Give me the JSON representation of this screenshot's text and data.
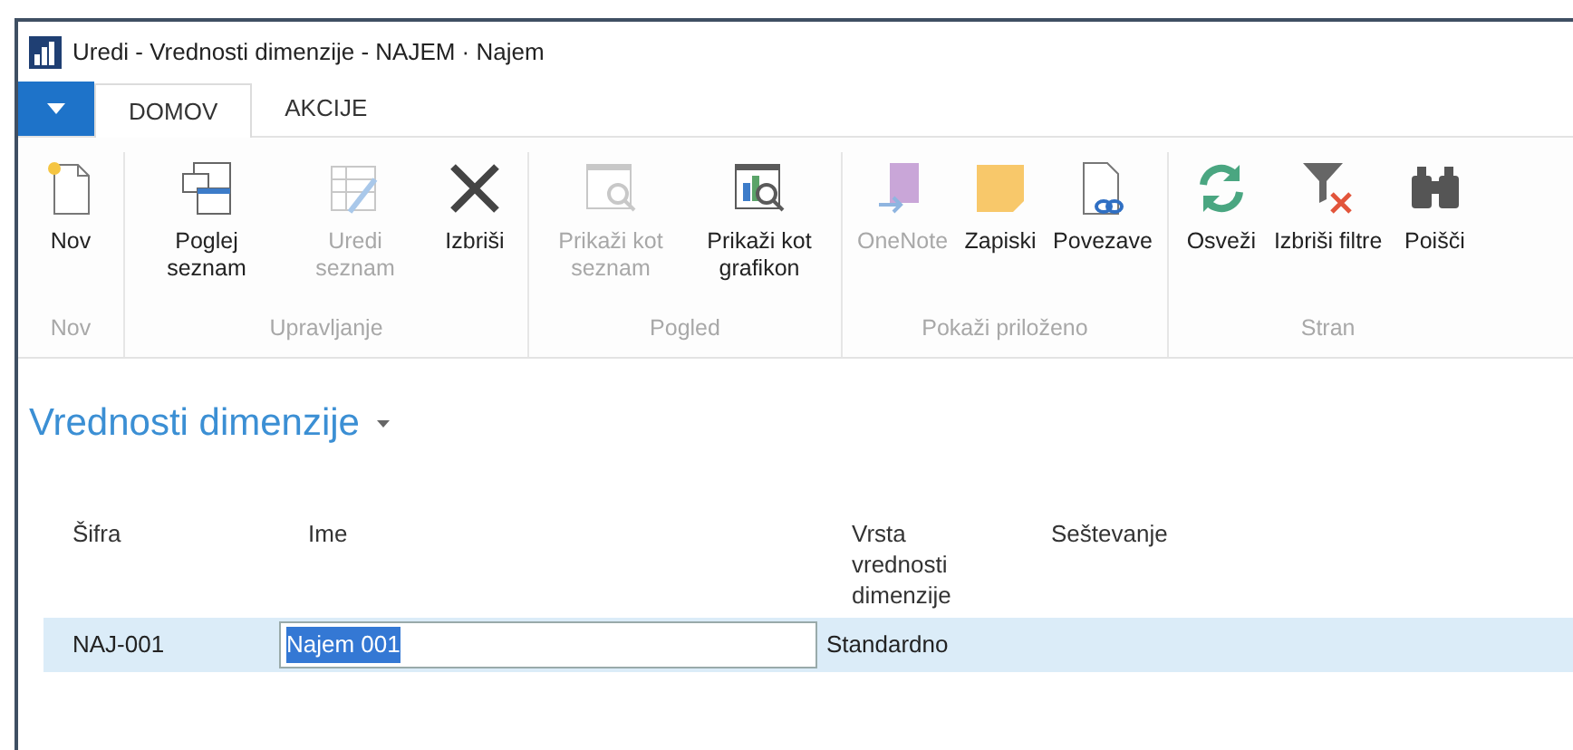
{
  "window": {
    "title": "Uredi - Vrednosti dimenzije - NAJEM · Najem"
  },
  "tabs": [
    {
      "label": "DOMOV",
      "selected": true
    },
    {
      "label": "AKCIJE",
      "selected": false
    }
  ],
  "ribbon": {
    "groups": [
      {
        "label": "Nov",
        "buttons": [
          {
            "kind": "new",
            "label": "Nov",
            "disabled": false
          }
        ]
      },
      {
        "label": "Upravljanje",
        "buttons": [
          {
            "kind": "view-list",
            "label": "Poglej seznam",
            "disabled": false
          },
          {
            "kind": "edit-list",
            "label": "Uredi seznam",
            "disabled": true
          },
          {
            "kind": "delete",
            "label": "Izbriši",
            "disabled": false
          }
        ]
      },
      {
        "label": "Pogled",
        "buttons": [
          {
            "kind": "show-list",
            "label": "Prikaži kot seznam",
            "disabled": true
          },
          {
            "kind": "show-chart",
            "label": "Prikaži kot grafikon",
            "disabled": false
          }
        ]
      },
      {
        "label": "Pokaži priloženo",
        "buttons": [
          {
            "kind": "onenote",
            "label": "OneNote",
            "disabled": true
          },
          {
            "kind": "notes",
            "label": "Zapiski",
            "disabled": false
          },
          {
            "kind": "links",
            "label": "Povezave",
            "disabled": false
          }
        ]
      },
      {
        "label": "Stran",
        "buttons": [
          {
            "kind": "refresh",
            "label": "Osveži",
            "disabled": false
          },
          {
            "kind": "clear-filter",
            "label": "Izbriši filtre",
            "disabled": false
          },
          {
            "kind": "find",
            "label": "Poišči",
            "disabled": false
          }
        ]
      }
    ]
  },
  "page": {
    "title": "Vrednosti dimenzije"
  },
  "table": {
    "columns": [
      "Šifra",
      "Ime",
      "Vrsta vrednosti dimenzije",
      "Seštevanje"
    ],
    "rows": [
      {
        "selected": true,
        "cells": [
          "NAJ-001",
          "Najem 001",
          "Standardno",
          ""
        ]
      }
    ]
  }
}
